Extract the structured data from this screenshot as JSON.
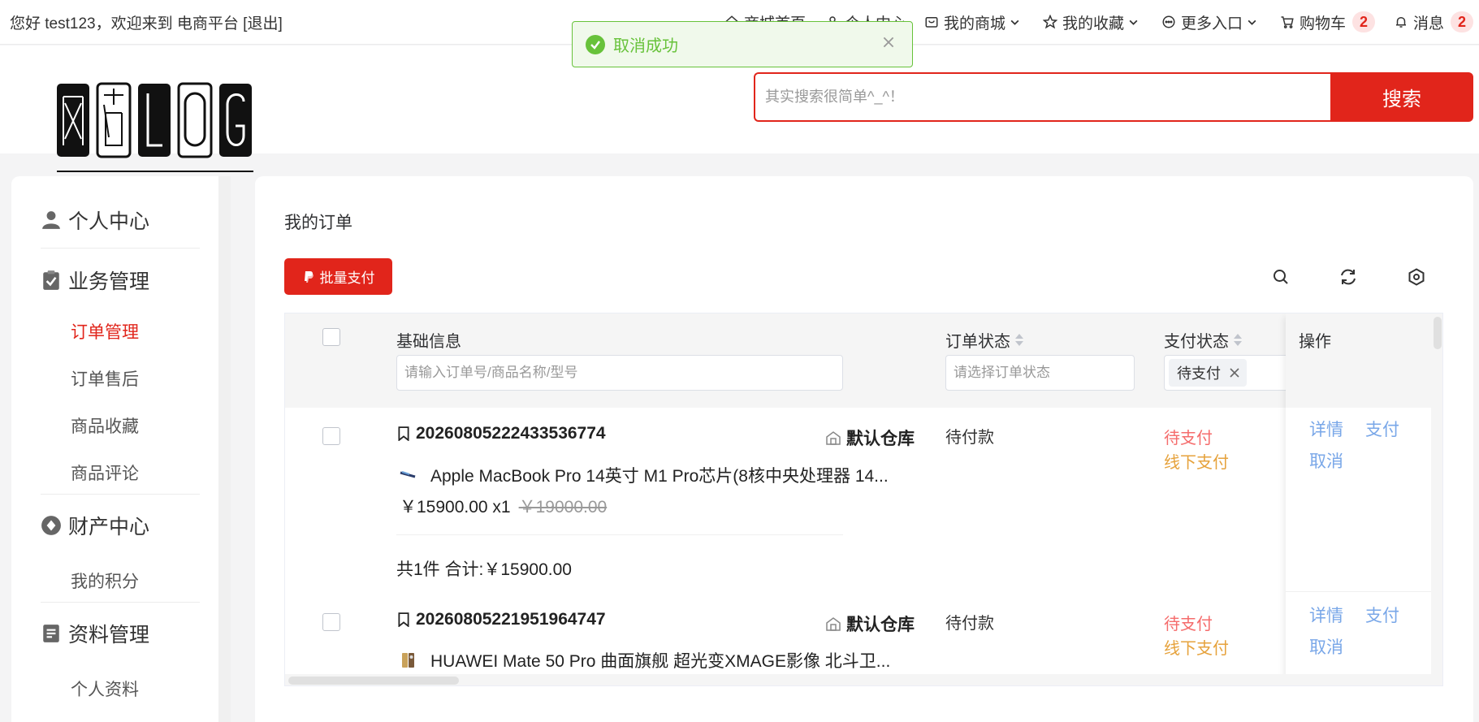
{
  "topbar": {
    "welcome": "您好 test123，欢迎来到 电商平台",
    "logout": "[退出]",
    "nav": {
      "home": "商城首页",
      "personal": "个人中心",
      "my_mall": "我的商城",
      "favorites": "我的收藏",
      "more": "更多入口",
      "cart": "购物车",
      "cart_count": "2",
      "messages": "消息",
      "message_count": "2"
    }
  },
  "toast": {
    "message": "取消成功"
  },
  "search": {
    "placeholder": "其实搜索很简单^_^！",
    "button": "搜索"
  },
  "sidebar": {
    "groups": [
      {
        "title": "个人中心",
        "icon": "user-icon"
      },
      {
        "title": "业务管理",
        "icon": "clipboard-check-icon",
        "items": [
          "订单管理",
          "订单售后",
          "商品收藏",
          "商品评论"
        ]
      },
      {
        "title": "财产中心",
        "icon": "diamond-icon",
        "items": [
          "我的积分"
        ]
      },
      {
        "title": "资料管理",
        "icon": "document-icon",
        "items": [
          "个人资料"
        ]
      }
    ],
    "active": "订单管理"
  },
  "main": {
    "title": "我的订单",
    "batch_pay": "批量支付",
    "tools": [
      "search-icon",
      "refresh-icon",
      "settings-icon"
    ],
    "table": {
      "columns": [
        "基础信息",
        "订单状态",
        "支付状态",
        "操作"
      ],
      "filters": {
        "basic_placeholder": "请输入订单号/商品名称/型号",
        "status_placeholder": "请选择订单状态",
        "pay_tag": "待支付"
      },
      "rows": [
        {
          "order_no": "20260805222433536774",
          "warehouse": "默认仓库",
          "product": "Apple MacBook Pro 14英寸 M1 Pro芯片(8核中央处理器 14...",
          "price": "￥15900.00 x1",
          "original_price": "￥19000.00",
          "summary": "共1件 合计:￥15900.00",
          "order_status": "待付款",
          "pay_status": "待支付",
          "pay_method": "线下支付",
          "actions": [
            "详情",
            "支付",
            "取消"
          ]
        },
        {
          "order_no": "20260805221951964747",
          "warehouse": "默认仓库",
          "product": "HUAWEI Mate 50 Pro 曲面旗舰 超光变XMAGE影像 北斗卫...",
          "order_status": "待付款",
          "pay_status": "待支付",
          "pay_method": "线下支付",
          "actions": [
            "详情",
            "支付",
            "取消"
          ]
        }
      ]
    }
  },
  "colors": {
    "brand": "#e1251b",
    "success": "#67c23a",
    "link": "#79a7e8",
    "warning": "#e6a23c",
    "danger": "#f56c6c"
  }
}
